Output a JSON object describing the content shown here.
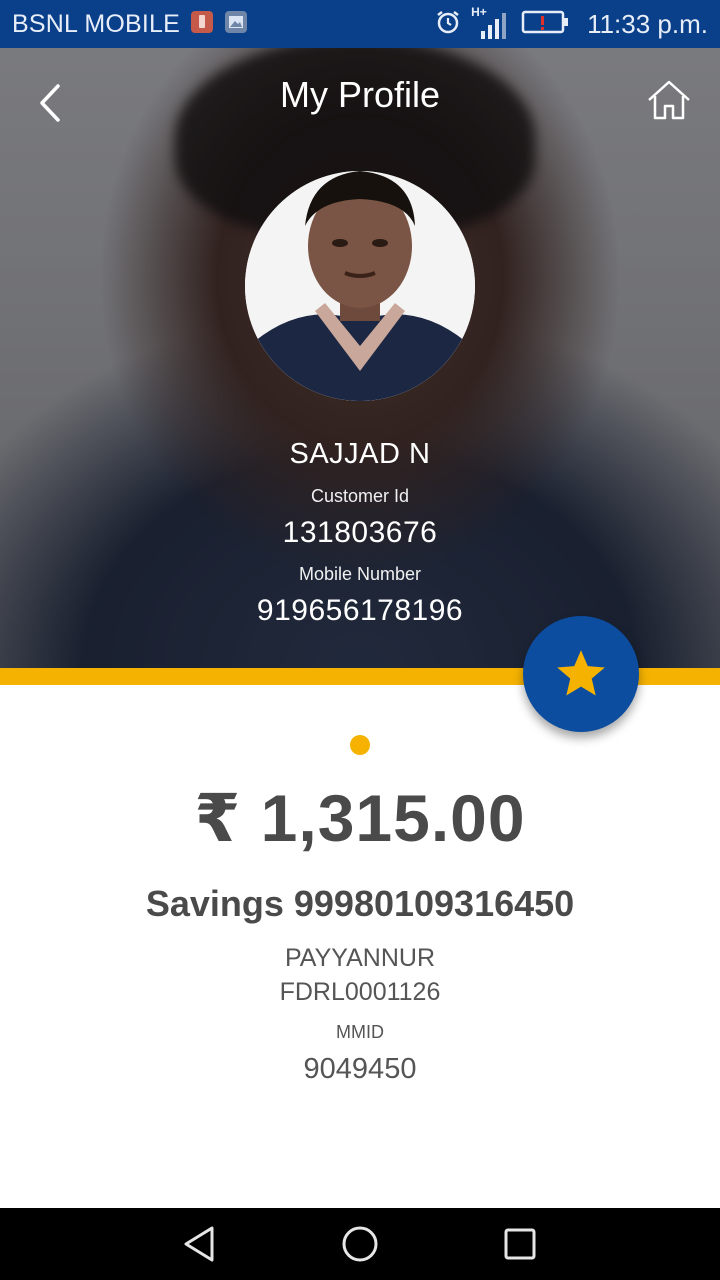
{
  "status_bar": {
    "carrier": "BSNL MOBILE",
    "network": "H+",
    "time": "11:33 p.m."
  },
  "header": {
    "title": "My Profile"
  },
  "profile": {
    "name": "SAJJAD N",
    "customer_id_label": "Customer Id",
    "customer_id": "131803676",
    "mobile_label": "Mobile Number",
    "mobile": "919656178196"
  },
  "account": {
    "balance": "₹ 1,315.00",
    "account_line": "Savings 99980109316450",
    "branch": "PAYYANNUR",
    "ifsc": "FDRL0001126",
    "mmid_label": "MMID",
    "mmid": "9049450"
  },
  "colors": {
    "status_bar": "#0a3f8a",
    "accent_yellow": "#f5b200",
    "fab_blue": "#0c4da0",
    "text_dark": "#4a4a4a"
  },
  "icons": {
    "back": "chevron-left-icon",
    "home": "home-icon",
    "favourite": "star-icon",
    "nav_back": "triangle-back-icon",
    "nav_home": "circle-home-icon",
    "nav_recents": "square-recents-icon"
  }
}
